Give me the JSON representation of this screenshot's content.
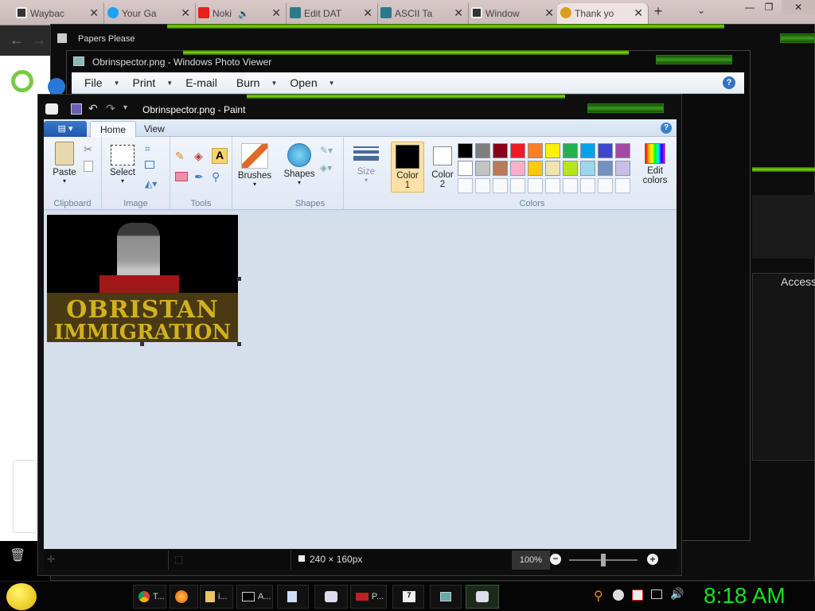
{
  "browser": {
    "tabs": [
      {
        "label": "Waybac",
        "icon": "archive-icon"
      },
      {
        "label": "Your Ga",
        "icon": "twitter-icon"
      },
      {
        "label": "Noki",
        "icon": "youtube-icon"
      },
      {
        "label": "Edit DAT",
        "icon": "tab-icon"
      },
      {
        "label": "ASCII Ta",
        "icon": "tab-icon"
      },
      {
        "label": "Window",
        "icon": "archive-icon"
      },
      {
        "label": "Thank yo",
        "icon": "globe-icon"
      }
    ],
    "new_tab": "+"
  },
  "windows": {
    "papers_please_title": "Papers Please",
    "photo_viewer_title": "Obrinspector.png - Windows Photo Viewer",
    "photo_viewer_menu": [
      "File",
      "Print",
      "E-mail",
      "Burn",
      "Open"
    ],
    "background_panel_text": "Access"
  },
  "paint": {
    "title": "Obrinspector.png - Paint",
    "tabs": [
      "Home",
      "View"
    ],
    "groups": {
      "clipboard": "Clipboard",
      "image": "Image",
      "tools": "Tools",
      "shapes": "Shapes",
      "colors": "Colors"
    },
    "buttons": {
      "paste": "Paste",
      "select": "Select",
      "brushes": "Brushes",
      "shapes": "Shapes",
      "size": "Size",
      "color1_a": "Color",
      "color1_b": "1",
      "color2_a": "Color",
      "color2_b": "2",
      "edit_colors_a": "Edit",
      "edit_colors_b": "colors"
    },
    "color1": "#000000",
    "color2": "#ffffff",
    "palette_row1": [
      "#000000",
      "#7f7f7f",
      "#880015",
      "#ed1c24",
      "#ff7f27",
      "#fff200",
      "#22b14c",
      "#00a2e8",
      "#3f48cc",
      "#a349a4"
    ],
    "palette_row2": [
      "#ffffff",
      "#c3c3c3",
      "#b97a57",
      "#ffaec9",
      "#ffc90e",
      "#efe4b0",
      "#b5e61d",
      "#99d9ea",
      "#7092be",
      "#c8bfe7"
    ],
    "canvas_text_line1": "OBRISTAN",
    "canvas_text_line2": "IMMIGRATION",
    "status_size": "240 × 160px",
    "zoom": "100%"
  },
  "taskbar": {
    "items": [
      {
        "label": "T...",
        "icon": "chrome-icon"
      },
      {
        "label": "",
        "icon": "firefox-icon"
      },
      {
        "label": "i...",
        "icon": "folder-icon"
      },
      {
        "label": "A...",
        "icon": "cmd-icon"
      },
      {
        "label": "",
        "icon": "document-icon"
      },
      {
        "label": "",
        "icon": "paint-icon"
      },
      {
        "label": "P...",
        "icon": "papers-please-icon"
      },
      {
        "label": "",
        "icon": "7zip-icon"
      },
      {
        "label": "",
        "icon": "photo-viewer-icon"
      },
      {
        "label": "",
        "icon": "paint-icon"
      }
    ],
    "clock": "8:18 AM"
  }
}
